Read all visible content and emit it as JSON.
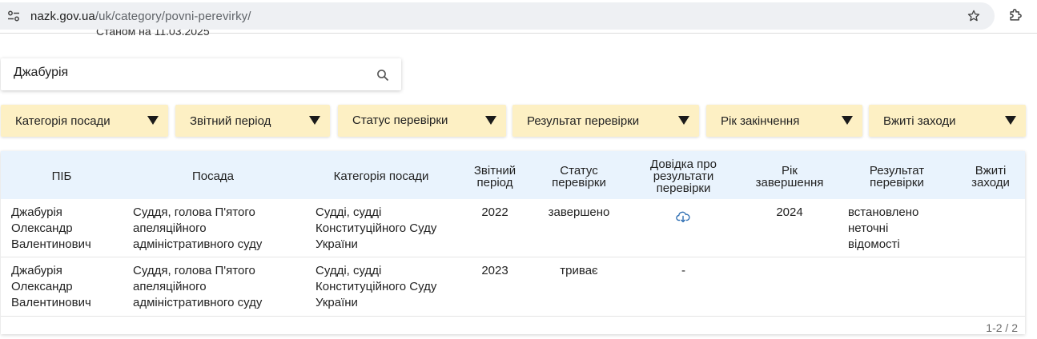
{
  "browser": {
    "url_host": "nazk.gov.ua",
    "url_path": "/uk/category/povni-perevirky/"
  },
  "page": {
    "as_of": "Станом на 11.03.2025"
  },
  "search": {
    "value": "Джабурія"
  },
  "filters": [
    {
      "label": "Категорія посади"
    },
    {
      "label": "Звітний період"
    },
    {
      "label": "Статус перевірки"
    },
    {
      "label": "Результат перевірки"
    },
    {
      "label": "Рік закінчення"
    },
    {
      "label": "Вжиті заходи"
    }
  ],
  "table": {
    "headers": {
      "pib": "ПІБ",
      "position": "Посада",
      "category": "Категорія посади",
      "period_1": "Звітний",
      "period_2": "період",
      "status_1": "Статус",
      "status_2": "перевірки",
      "report_1": "Довідка про",
      "report_2": "результати",
      "report_3": "перевірки",
      "year_1": "Рік",
      "year_2": "завершення",
      "result_1": "Результат",
      "result_2": "перевірки",
      "measures_1": "Вжиті",
      "measures_2": "заходи"
    },
    "rows": [
      {
        "pib_1": "Джабурія",
        "pib_2": "Олександр",
        "pib_3": "Валентинович",
        "position_1": "Суддя, голова П'ятого",
        "position_2": "апеляційного",
        "position_3": "адміністративного суду",
        "category_1": "Судді, судді",
        "category_2": "Конституційного Суду",
        "category_3": "України",
        "period": "2022",
        "status": "завершено",
        "report": "download-cloud-icon",
        "year": "2024",
        "result_1": "встановлено",
        "result_2": "неточні",
        "result_3": "відомості",
        "measures": ""
      },
      {
        "pib_1": "Джабурія",
        "pib_2": "Олександр",
        "pib_3": "Валентинович",
        "position_1": "Суддя, голова П'ятого",
        "position_2": "апеляційного",
        "position_3": "адміністративного суду",
        "category_1": "Судді, судді",
        "category_2": "Конституційного Суду",
        "category_3": "України",
        "period": "2023",
        "status": "триває",
        "report": "-",
        "year": "",
        "result_1": "",
        "result_2": "",
        "result_3": "",
        "measures": ""
      }
    ],
    "pagination": "1-2 / 2"
  }
}
